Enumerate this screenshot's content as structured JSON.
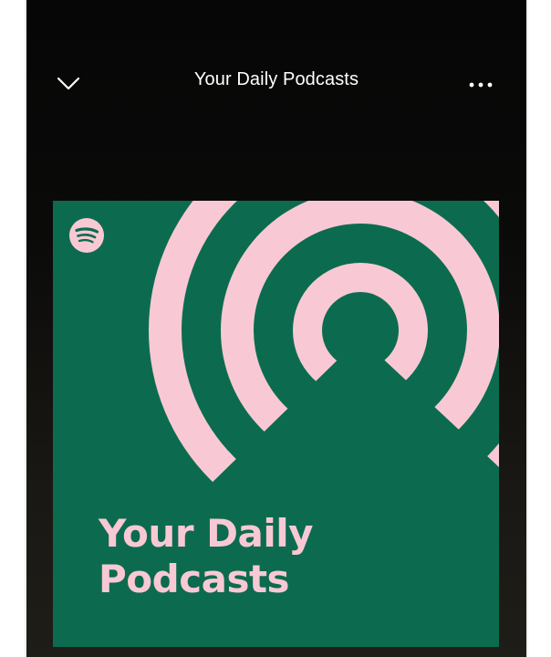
{
  "header": {
    "title": "Your Daily Podcasts",
    "collapse_icon": "chevron-down-icon",
    "more_icon": "more-horizontal-icon"
  },
  "cover": {
    "brand_icon": "spotify-icon",
    "title_line1": "Your Daily",
    "title_line2": "Podcasts",
    "colors": {
      "background": "#0c6b4e",
      "accent": "#f8c9d4"
    }
  }
}
